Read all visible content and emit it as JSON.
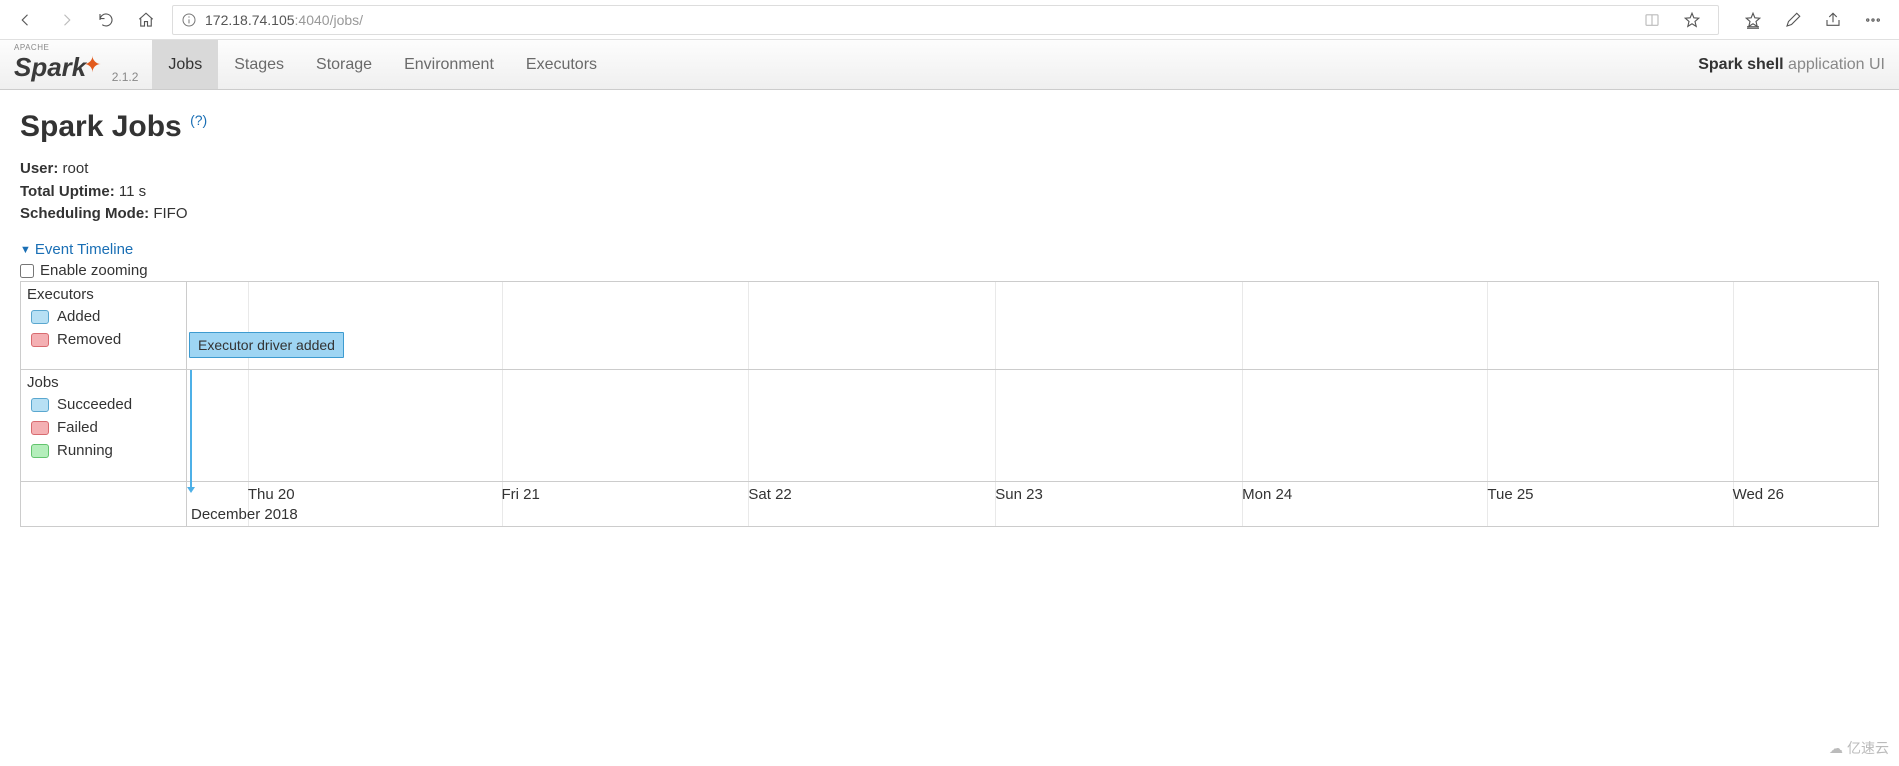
{
  "browser": {
    "url_host": "172.18.74.105",
    "url_port": ":4040",
    "url_path": "/jobs/"
  },
  "navbar": {
    "logo_pretext": "APACHE",
    "logo_text": "Spark",
    "version": "2.1.2",
    "tabs": [
      {
        "label": "Jobs",
        "active": true
      },
      {
        "label": "Stages",
        "active": false
      },
      {
        "label": "Storage",
        "active": false
      },
      {
        "label": "Environment",
        "active": false
      },
      {
        "label": "Executors",
        "active": false
      }
    ],
    "app_name": "Spark shell",
    "app_suffix": "application UI"
  },
  "page": {
    "title": "Spark Jobs",
    "help": "(?)",
    "meta": {
      "user_label": "User:",
      "user_value": "root",
      "uptime_label": "Total Uptime:",
      "uptime_value": "11 s",
      "sched_label": "Scheduling Mode:",
      "sched_value": "FIFO"
    },
    "event_timeline": "Event Timeline",
    "enable_zoom": "Enable zooming"
  },
  "timeline": {
    "groups": {
      "executors": {
        "title": "Executors",
        "legend": [
          {
            "label": "Added",
            "swatch": "sw-added"
          },
          {
            "label": "Removed",
            "swatch": "sw-removed"
          }
        ]
      },
      "jobs": {
        "title": "Jobs",
        "legend": [
          {
            "label": "Succeeded",
            "swatch": "sw-succeeded"
          },
          {
            "label": "Failed",
            "swatch": "sw-failed"
          },
          {
            "label": "Running",
            "swatch": "sw-running"
          }
        ]
      }
    },
    "event_label": "Executor driver added",
    "axis_ticks": [
      {
        "label": "Thu 20",
        "left_pct": 3.6
      },
      {
        "label": "Fri 21",
        "left_pct": 18.6
      },
      {
        "label": "Sat 22",
        "left_pct": 33.2
      },
      {
        "label": "Sun 23",
        "left_pct": 47.8
      },
      {
        "label": "Mon 24",
        "left_pct": 62.4
      },
      {
        "label": "Tue 25",
        "left_pct": 76.9
      },
      {
        "label": "Wed 26",
        "left_pct": 91.4
      }
    ],
    "axis_month": "December 2018",
    "grid_positions_pct": [
      3.6,
      18.6,
      33.2,
      47.8,
      62.4,
      76.9,
      91.4
    ]
  },
  "watermark": "亿速云"
}
